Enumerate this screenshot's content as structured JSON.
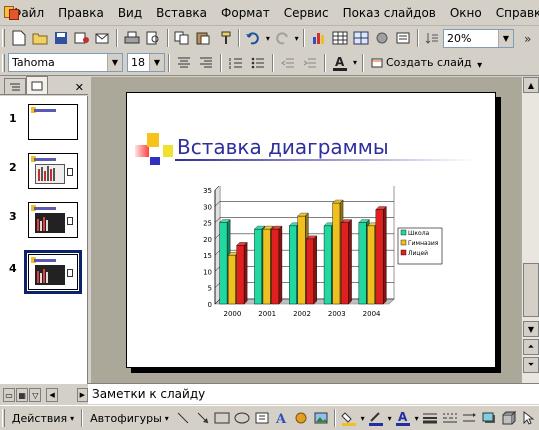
{
  "menu": {
    "items": [
      "Файл",
      "Правка",
      "Вид",
      "Вставка",
      "Формат",
      "Сервис",
      "Показ слайдов",
      "Окно",
      "Справка"
    ]
  },
  "toolbar": {
    "zoom": "20%",
    "font_name": "Tahoma",
    "font_size": "18",
    "new_slide_label": "Создать слайд"
  },
  "thumbnails": {
    "numbers": [
      "1",
      "2",
      "3",
      "4"
    ]
  },
  "slide": {
    "title": "Вставка диаграммы"
  },
  "chart_data": {
    "type": "bar",
    "categories": [
      "2000",
      "2001",
      "2002",
      "2003",
      "2004"
    ],
    "series": [
      {
        "name": "Школа",
        "values": [
          25,
          23,
          24,
          24,
          25
        ],
        "color": "#20d8a0"
      },
      {
        "name": "Гимназия",
        "values": [
          15,
          23,
          27,
          31,
          24
        ],
        "color": "#f0c020"
      },
      {
        "name": "Лицей",
        "values": [
          18,
          23,
          20,
          25,
          29
        ],
        "color": "#e02020"
      }
    ],
    "ylim": [
      0,
      35
    ],
    "yticks": [
      "0",
      "5",
      "10",
      "15",
      "20",
      "25",
      "30",
      "35"
    ],
    "grid": true,
    "legend_position": "right"
  },
  "notes": {
    "placeholder": "Заметки к слайду"
  },
  "drawing_toolbar": {
    "actions_label": "Действия",
    "autoshapes_label": "Автофигуры"
  }
}
